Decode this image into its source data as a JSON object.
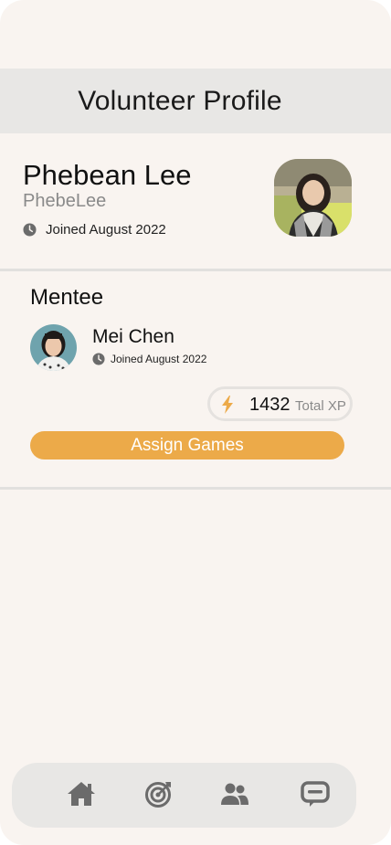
{
  "header": {
    "title": "Volunteer Profile"
  },
  "profile": {
    "name": "Phebean Lee",
    "username": "PhebeLee",
    "joined": "Joined August 2022",
    "avatar_icon": "profile-photo"
  },
  "mentee_section": {
    "title": "Mentee",
    "mentee": {
      "name": "Mei Chen",
      "joined": "Joined August 2022",
      "avatar_icon": "mentee-photo"
    },
    "xp": {
      "value": "1432",
      "label": "Total XP",
      "icon": "lightning-bolt-icon"
    },
    "assign_button_label": "Assign Games"
  },
  "bottom_nav": {
    "items": [
      {
        "icon": "home-icon"
      },
      {
        "icon": "target-icon"
      },
      {
        "icon": "people-icon"
      },
      {
        "icon": "chat-icon"
      }
    ]
  },
  "colors": {
    "background": "#f9f4f0",
    "header_bg": "#e8e7e5",
    "accent": "#ecaa49",
    "icon_gray": "#6b6b6b"
  }
}
